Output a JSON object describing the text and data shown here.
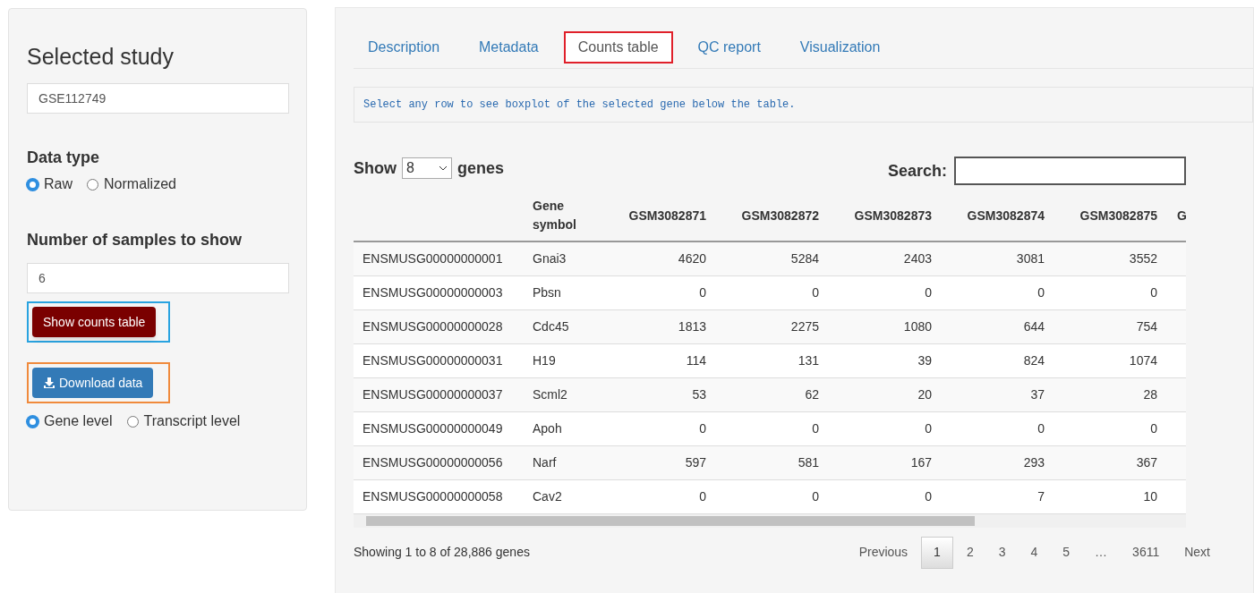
{
  "sidebar": {
    "title": "Selected study",
    "study_field": {
      "value": "GSE112749"
    },
    "data_type": {
      "label": "Data type",
      "options": [
        {
          "label": "Raw",
          "selected": true
        },
        {
          "label": "Normalized",
          "selected": false
        }
      ]
    },
    "samples": {
      "label": "Number of samples to show",
      "value": "6"
    },
    "buttons": [
      {
        "kind": "show",
        "label": "Show counts table",
        "highlighted": true
      },
      {
        "kind": "download",
        "label": "Download data",
        "highlighted": true
      }
    ],
    "level": {
      "options": [
        {
          "label": "Gene level",
          "selected": true
        },
        {
          "label": "Transcript level",
          "selected": false
        }
      ]
    }
  },
  "tabs": [
    {
      "label": "Description",
      "selected": false,
      "highlighted": false
    },
    {
      "label": "Metadata",
      "selected": false,
      "highlighted": false
    },
    {
      "label": "Counts table",
      "selected": true,
      "highlighted": true
    },
    {
      "label": "QC report",
      "selected": false,
      "highlighted": false
    },
    {
      "label": "Visualization",
      "selected": false,
      "highlighted": false
    }
  ],
  "info": "Select any row to see boxplot of the selected gene below the table.",
  "length": {
    "prefix": "Show",
    "value": "8",
    "suffix": "genes"
  },
  "search": {
    "label": "Search:"
  },
  "table": {
    "columns": [
      "",
      "Gene symbol",
      "GSM3082871",
      "GSM3082872",
      "GSM3082873",
      "GSM3082874",
      "GSM3082875",
      "G"
    ],
    "rows": [
      [
        "ENSMUSG00000000001",
        "Gnai3",
        "4620",
        "5284",
        "2403",
        "3081",
        "3552"
      ],
      [
        "ENSMUSG00000000003",
        "Pbsn",
        "0",
        "0",
        "0",
        "0",
        "0"
      ],
      [
        "ENSMUSG00000000028",
        "Cdc45",
        "1813",
        "2275",
        "1080",
        "644",
        "754"
      ],
      [
        "ENSMUSG00000000031",
        "H19",
        "114",
        "131",
        "39",
        "824",
        "1074"
      ],
      [
        "ENSMUSG00000000037",
        "Scml2",
        "53",
        "62",
        "20",
        "37",
        "28"
      ],
      [
        "ENSMUSG00000000049",
        "Apoh",
        "0",
        "0",
        "0",
        "0",
        "0"
      ],
      [
        "ENSMUSG00000000056",
        "Narf",
        "597",
        "581",
        "167",
        "293",
        "367"
      ],
      [
        "ENSMUSG00000000058",
        "Cav2",
        "0",
        "0",
        "0",
        "7",
        "10"
      ]
    ]
  },
  "footer": {
    "summary": "Showing 1 to 8 of 28,886 genes",
    "pages": [
      {
        "label": "Previous",
        "selected": false
      },
      {
        "label": "1",
        "selected": true
      },
      {
        "label": "2",
        "selected": false
      },
      {
        "label": "3",
        "selected": false
      },
      {
        "label": "4",
        "selected": false
      },
      {
        "label": "5",
        "selected": false
      },
      {
        "label": "…",
        "selected": false
      },
      {
        "label": "3611",
        "selected": false
      },
      {
        "label": "Next",
        "selected": false
      }
    ]
  }
}
